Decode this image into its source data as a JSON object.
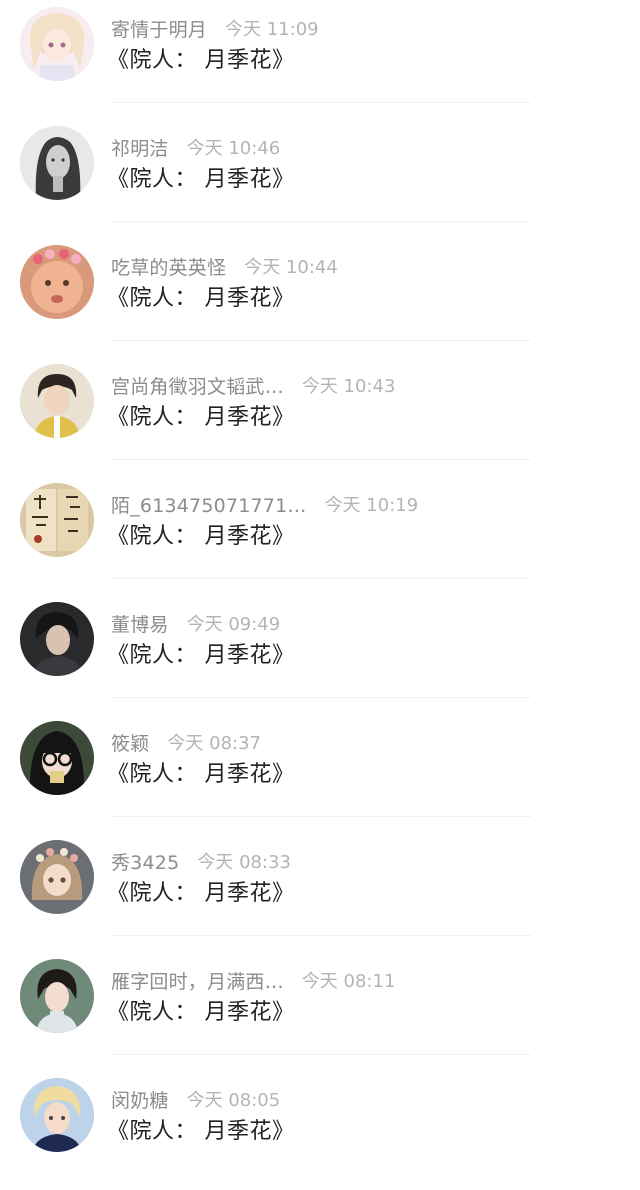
{
  "comments": [
    {
      "name": "寄情于明月",
      "time": "今天 11:09",
      "text": "《院人： 月季花》",
      "avatar": "anime-girl-pink-hair"
    },
    {
      "name": "祁明洁",
      "time": "今天 10:46",
      "text": "《院人： 月季花》",
      "avatar": "bw-woman-portrait"
    },
    {
      "name": "吃草的英英怪",
      "time": "今天 10:44",
      "text": "《院人： 月季花》",
      "avatar": "filtered-face-flowers"
    },
    {
      "name": "宫尚角徵羽文韬武…",
      "time": "今天 10:43",
      "text": "《院人： 月季花》",
      "avatar": "young-man-yellow-vest"
    },
    {
      "name": "陌_613475071771…",
      "time": "今天 10:19",
      "text": "《院人： 月季花》",
      "avatar": "calligraphy-book"
    },
    {
      "name": "董博易",
      "time": "今天 09:49",
      "text": "《院人： 月季花》",
      "avatar": "dark-hair-man"
    },
    {
      "name": "筱颖",
      "time": "今天 08:37",
      "text": "《院人： 月季花》",
      "avatar": "girl-glasses-bangs"
    },
    {
      "name": "秀3425",
      "time": "今天 08:33",
      "text": "《院人： 月季花》",
      "avatar": "anime-girl-flower-crown"
    },
    {
      "name": "雁字回时，月满西…",
      "time": "今天 08:11",
      "text": "《院人： 月季花》",
      "avatar": "illustrated-woman-qipao"
    },
    {
      "name": "闵奶糖",
      "time": "今天 08:05",
      "text": "《院人： 月季花》",
      "avatar": "blonde-man"
    }
  ]
}
